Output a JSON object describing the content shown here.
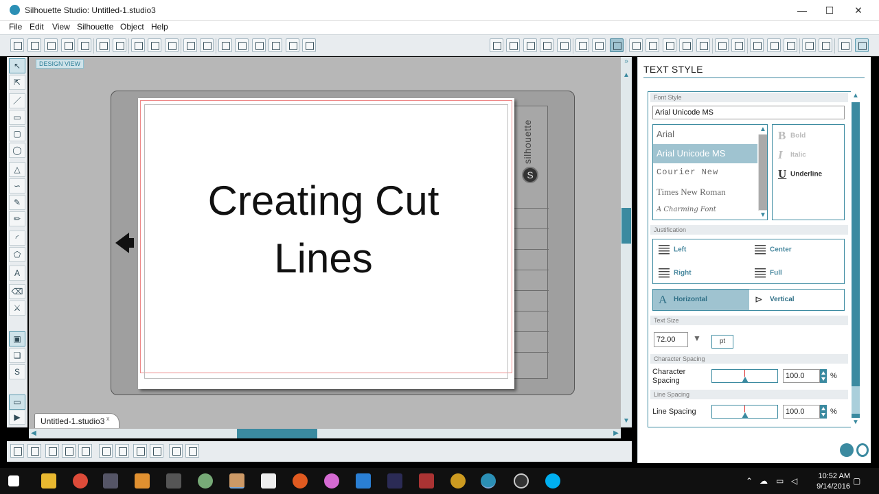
{
  "window": {
    "title": "Silhouette Studio: Untitled-1.studio3",
    "minimize": "—",
    "maximize": "☐",
    "close": "✕"
  },
  "menu": [
    "File",
    "Edit",
    "View",
    "Silhouette",
    "Object",
    "Help"
  ],
  "canvas": {
    "design_view_label": "DESIGN VIEW",
    "page_text_line1": "Creating Cut",
    "page_text_line2": "Lines",
    "brand_text": "silhouette",
    "brand_logo": "S",
    "doc_tab_label": "Untitled-1.studio3",
    "doc_tab_close": "x"
  },
  "panel": {
    "title": "TEXT STYLE",
    "font_style_header": "Font Style",
    "font_input_value": "Arial Unicode MS",
    "fonts": [
      "Arial",
      "Arial Unicode MS",
      "Courier New",
      "Times New Roman",
      "A Charming Font"
    ],
    "selected_font": "Arial Unicode MS",
    "styles": [
      {
        "glyph": "B",
        "label": "Bold",
        "enabled": false
      },
      {
        "glyph": "I",
        "label": "Italic",
        "enabled": false
      },
      {
        "glyph": "U",
        "label": "Underline",
        "enabled": true
      }
    ],
    "justification_header": "Justification",
    "justification": {
      "left": "Left",
      "center": "Center",
      "right": "Right",
      "full": "Full"
    },
    "orientation": {
      "horizontal": "Horizontal",
      "vertical": "Vertical",
      "selected": "Horizontal"
    },
    "text_size_header": "Text Size",
    "text_size_value": "72.00",
    "text_size_unit": "pt",
    "char_spacing_header": "Character Spacing",
    "char_spacing_label": "Character Spacing",
    "char_spacing_value": "100.0",
    "line_spacing_header": "Line Spacing",
    "line_spacing_label": "Line Spacing",
    "line_spacing_value": "100.0",
    "percent": "%"
  },
  "taskbar": {
    "time": "10:52 AM",
    "date": "9/14/2016"
  },
  "colors": {
    "accent": "#3b8aa0",
    "accent_light": "#9fc3d0",
    "canvas_bg": "#b7b7b7",
    "mat": "#9f9f9f",
    "taskbar": "#101010"
  },
  "icons": {
    "toolbar": [
      "new-document-icon",
      "open-icon",
      "open-library-icon",
      "save-icon",
      "save-to-library-icon",
      "print-icon",
      "print-cut-icon",
      "copy-icon",
      "paste-icon",
      "cut-icon",
      "undo-icon",
      "redo-icon",
      "pan-icon",
      "zoom-in-icon",
      "zoom-out-icon",
      "zoom-select-icon",
      "zoom-fit-icon",
      "fit-to-window-icon",
      "page-setup-icon",
      "grid-icon",
      "registration-marks-icon",
      "cut-settings-icon",
      "fill-color-icon",
      "line-color-icon",
      "line-style-icon",
      "text-style-icon",
      "transform-icon",
      "replicate-icon",
      "align-icon",
      "offset-icon",
      "trace-icon",
      "modify-icon",
      "send-to-silhouette-icon",
      "library-icon",
      "store-icon",
      "knife-icon",
      "eraser-icon"
    ],
    "left_tools": [
      "select-icon",
      "point-edit-icon",
      "line-icon",
      "rectangle-icon",
      "rounded-rectangle-icon",
      "ellipse-icon",
      "polygon-icon",
      "curve-icon",
      "freehand-icon",
      "smooth-freehand-icon",
      "arc-icon",
      "regular-polygon-icon",
      "text-icon",
      "eraser-icon",
      "knife-icon",
      "library-icon",
      "store-icon",
      "silhouette-logo-icon",
      "cut-preview-icon",
      "play-icon"
    ]
  }
}
